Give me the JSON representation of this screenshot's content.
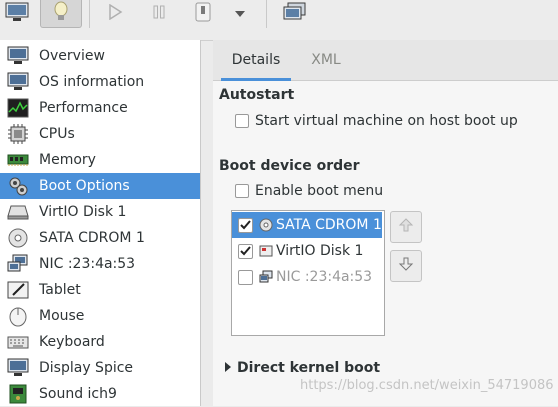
{
  "toolbar": {
    "buttons": [
      {
        "icon": "monitor-icon"
      },
      {
        "icon": "lightbulb-icon",
        "pressed": true
      },
      {
        "icon": "play-icon"
      },
      {
        "icon": "pause-icon"
      },
      {
        "icon": "power-icon"
      },
      {
        "icon": "dropdown-arrow-icon"
      },
      {
        "icon": "console-icon"
      }
    ]
  },
  "sidebar": {
    "items": [
      {
        "label": "Overview",
        "icon": "monitor-icon"
      },
      {
        "label": "OS information",
        "icon": "monitor-icon"
      },
      {
        "label": "Performance",
        "icon": "performance-graph-icon"
      },
      {
        "label": "CPUs",
        "icon": "cpu-icon"
      },
      {
        "label": "Memory",
        "icon": "memory-icon"
      },
      {
        "label": "Boot Options",
        "icon": "gear-icon",
        "selected": true
      },
      {
        "label": "VirtIO Disk 1",
        "icon": "disk-icon"
      },
      {
        "label": "SATA CDROM 1",
        "icon": "cdrom-icon"
      },
      {
        "label": "NIC :23:4a:53",
        "icon": "network-icon"
      },
      {
        "label": "Tablet",
        "icon": "tablet-icon"
      },
      {
        "label": "Mouse",
        "icon": "mouse-icon"
      },
      {
        "label": "Keyboard",
        "icon": "keyboard-icon"
      },
      {
        "label": "Display Spice",
        "icon": "display-icon"
      },
      {
        "label": "Sound ich9",
        "icon": "sound-icon"
      }
    ]
  },
  "tabs": [
    {
      "label": "Details",
      "active": true
    },
    {
      "label": "XML",
      "active": false
    }
  ],
  "autostart": {
    "heading": "Autostart",
    "checkbox_label": "Start virtual machine on host boot up",
    "checked": false
  },
  "boot_order": {
    "heading": "Boot device order",
    "enable_menu_label": "Enable boot menu",
    "enable_menu_checked": false,
    "devices": [
      {
        "label": "SATA CDROM 1",
        "checked": true,
        "selected": true,
        "icon": "cdrom-icon"
      },
      {
        "label": "VirtIO Disk 1",
        "checked": true,
        "selected": false,
        "icon": "disk-icon"
      },
      {
        "label": "NIC :23:4a:53",
        "checked": false,
        "selected": false,
        "icon": "network-icon"
      }
    ]
  },
  "kernel_boot": {
    "label": "Direct kernel boot",
    "expanded": false
  },
  "watermark": "https://blog.csdn.net/weixin_54719086"
}
